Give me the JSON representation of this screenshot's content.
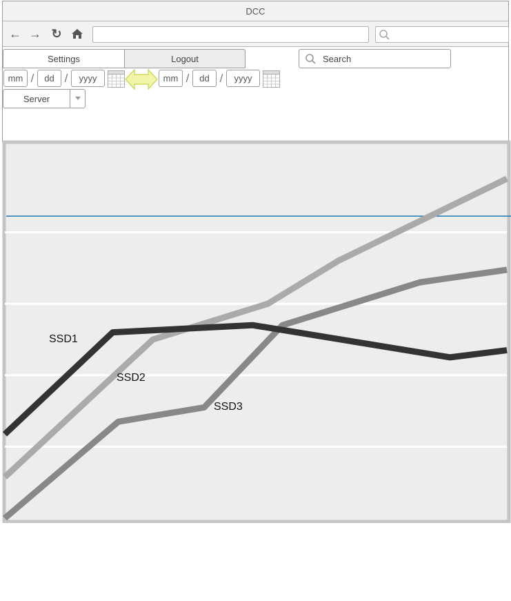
{
  "window": {
    "title": "DCC"
  },
  "nav": {
    "back_icon": "arrow-left-icon",
    "forward_icon": "arrow-right-icon",
    "reload_icon": "reload-icon",
    "home_icon": "home-icon",
    "url_value": "",
    "search_value": ""
  },
  "tabs": [
    {
      "label": "Settings"
    },
    {
      "label": "Logout"
    }
  ],
  "search": {
    "placeholder": "Search"
  },
  "date_from": {
    "month": "mm",
    "day": "dd",
    "year": "yyyy"
  },
  "date_to": {
    "month": "mm",
    "day": "dd",
    "year": "yyyy"
  },
  "range_icon": "double-arrow-icon",
  "server_select": {
    "selected": "Server"
  },
  "colors": {
    "ssd1": "#333333",
    "ssd2": "#aaaaaa",
    "ssd3": "#888888",
    "threshold": "#1f77b4",
    "plot_bg": "#ededed",
    "range_arrow": "#f0f5a8"
  },
  "chart_data": {
    "type": "line",
    "title": "",
    "xlabel": "",
    "ylabel": "",
    "xlim": [
      0,
      100
    ],
    "ylim": [
      0,
      100
    ],
    "grid": "horizontal",
    "legend": "inline labels",
    "threshold": 84.5,
    "series": [
      {
        "name": "SSD1",
        "x": [
          0,
          21.5,
          49.4,
          88.7,
          100
        ],
        "y": [
          23.5,
          52,
          54,
          45,
          47
        ]
      },
      {
        "name": "SSD2",
        "x": [
          0,
          29.5,
          52.4,
          66.4,
          100
        ],
        "y": [
          11.5,
          50,
          60,
          72,
          95
        ]
      },
      {
        "name": "SSD3",
        "x": [
          0,
          22.6,
          39.7,
          55.3,
          82.7,
          100
        ],
        "y": [
          0,
          27,
          31,
          54,
          66,
          69.5
        ]
      }
    ]
  }
}
